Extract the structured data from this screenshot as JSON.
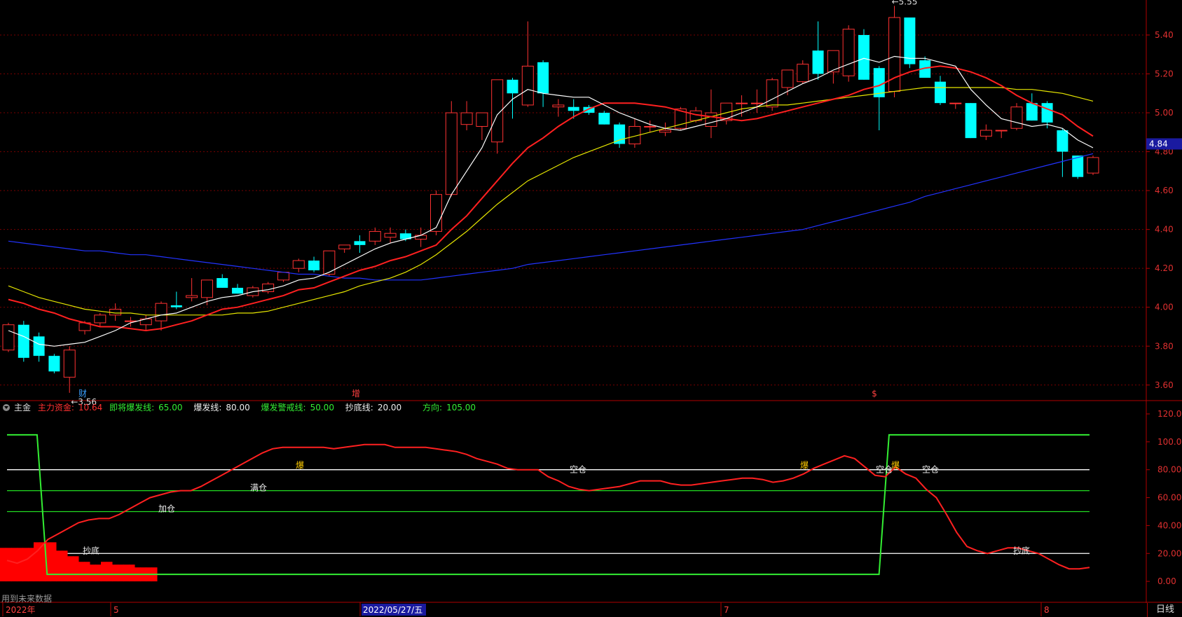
{
  "colors": {
    "up": "#ff3232",
    "down": "#00ffff",
    "ma5": "#ffffff",
    "ma10": "#ff2020",
    "ma20": "#e6e600",
    "ma60": "#2233ff",
    "grid": "#7a0000",
    "axis": "#b00000",
    "fund_line": "#ff2020",
    "direction_line": "#33ee33",
    "red_bars": "#ff0000"
  },
  "price_axis": {
    "ticks": [
      "5.40",
      "5.20",
      "5.00",
      "4.80",
      "4.60",
      "4.40",
      "4.20",
      "4.00",
      "3.80",
      "3.60"
    ],
    "last_price": "4.84"
  },
  "price_markers": {
    "low": "3.56",
    "high": "5.55"
  },
  "event_markers": [
    "财",
    "增",
    "$"
  ],
  "indicator": {
    "menu_icon": "menu-circle-icon",
    "name": "主金",
    "main_fund_label": "主力资金:",
    "main_fund_value": "10.64",
    "imminent_label": "即将爆发线:",
    "imminent_value": "65.00",
    "burst_label": "爆发线:",
    "burst_value": "80.00",
    "warn_label": "爆发警戒线:",
    "warn_value": "50.00",
    "bottom_label": "抄底线:",
    "bottom_value": "20.00",
    "dir_label": "方向:",
    "dir_value": "105.00",
    "axis_ticks": [
      "120.0",
      "100.0",
      "80.00",
      "60.00",
      "40.00",
      "20.00",
      "0.00"
    ],
    "annotations": [
      "抄底",
      "加仓",
      "满仓",
      "爆",
      "空仓",
      "爆",
      "空仓",
      "爆",
      "空仓",
      "抄底"
    ]
  },
  "timeline": {
    "labels": [
      "2022年",
      "5",
      "2022/05/27/五",
      "7",
      "8"
    ],
    "period": "日线"
  },
  "note": "用到未来数据",
  "chart_data": {
    "type": "candlestick",
    "price_range": [
      3.52,
      5.58
    ],
    "candles": [
      [
        3.78,
        3.92,
        3.77,
        3.91
      ],
      [
        3.91,
        3.93,
        3.72,
        3.74
      ],
      [
        3.85,
        3.87,
        3.72,
        3.75
      ],
      [
        3.75,
        3.76,
        3.66,
        3.67
      ],
      [
        3.64,
        3.8,
        3.56,
        3.78
      ],
      [
        3.88,
        3.93,
        3.86,
        3.92
      ],
      [
        3.92,
        3.97,
        3.9,
        3.96
      ],
      [
        3.96,
        4.02,
        3.93,
        3.99
      ],
      [
        3.93,
        3.95,
        3.9,
        3.93
      ],
      [
        3.91,
        3.96,
        3.88,
        3.94
      ],
      [
        3.93,
        4.03,
        3.88,
        4.02
      ],
      [
        4.01,
        4.08,
        3.99,
        4.0
      ],
      [
        4.05,
        4.15,
        4.03,
        4.06
      ],
      [
        4.05,
        4.13,
        4.01,
        4.14
      ],
      [
        4.15,
        4.17,
        4.1,
        4.1
      ],
      [
        4.1,
        4.12,
        4.07,
        4.07
      ],
      [
        4.06,
        4.11,
        4.05,
        4.1
      ],
      [
        4.08,
        4.13,
        4.07,
        4.12
      ],
      [
        4.14,
        4.18,
        4.13,
        4.18
      ],
      [
        4.2,
        4.25,
        4.18,
        4.24
      ],
      [
        4.24,
        4.26,
        4.18,
        4.19
      ],
      [
        4.17,
        4.26,
        4.16,
        4.29
      ],
      [
        4.3,
        4.32,
        4.28,
        4.32
      ],
      [
        4.34,
        4.37,
        4.28,
        4.32
      ],
      [
        4.34,
        4.41,
        4.32,
        4.39
      ],
      [
        4.36,
        4.41,
        4.33,
        4.38
      ],
      [
        4.38,
        4.4,
        4.34,
        4.35
      ],
      [
        4.35,
        4.41,
        4.31,
        4.37
      ],
      [
        4.39,
        4.6,
        4.37,
        4.58
      ],
      [
        4.58,
        5.06,
        4.57,
        5.0
      ],
      [
        4.94,
        5.06,
        4.91,
        5.0
      ],
      [
        4.93,
        5.0,
        4.86,
        5.0
      ],
      [
        4.85,
        5.17,
        4.79,
        5.17
      ],
      [
        5.17,
        5.18,
        4.97,
        5.1
      ],
      [
        5.04,
        5.47,
        5.03,
        5.24
      ],
      [
        5.26,
        5.27,
        5.03,
        5.1
      ],
      [
        5.03,
        5.07,
        4.98,
        5.04
      ],
      [
        5.03,
        5.07,
        4.97,
        5.01
      ],
      [
        5.03,
        5.04,
        4.99,
        5.0
      ],
      [
        5.0,
        5.01,
        4.94,
        4.94
      ],
      [
        4.94,
        4.95,
        4.82,
        4.84
      ],
      [
        4.84,
        4.97,
        4.82,
        4.93
      ],
      [
        4.93,
        4.96,
        4.9,
        4.93
      ],
      [
        4.9,
        4.95,
        4.88,
        4.91
      ],
      [
        4.92,
        5.03,
        4.91,
        5.02
      ],
      [
        4.96,
        5.03,
        4.95,
        5.01
      ],
      [
        4.93,
        5.12,
        4.87,
        5.0
      ],
      [
        4.96,
        5.04,
        4.94,
        5.05
      ],
      [
        5.05,
        5.09,
        4.98,
        5.05
      ],
      [
        5.05,
        5.12,
        5.0,
        5.05
      ],
      [
        5.03,
        5.18,
        5.01,
        5.17
      ],
      [
        5.13,
        5.22,
        5.09,
        5.22
      ],
      [
        5.16,
        5.27,
        5.15,
        5.25
      ],
      [
        5.32,
        5.47,
        5.17,
        5.2
      ],
      [
        5.21,
        5.32,
        5.15,
        5.32
      ],
      [
        5.19,
        5.45,
        5.16,
        5.43
      ],
      [
        5.4,
        5.43,
        5.17,
        5.17
      ],
      [
        5.23,
        5.24,
        4.91,
        5.08
      ],
      [
        5.11,
        5.55,
        5.08,
        5.49
      ],
      [
        5.49,
        5.49,
        5.23,
        5.25
      ],
      [
        5.27,
        5.29,
        5.2,
        5.18
      ],
      [
        5.16,
        5.19,
        5.04,
        5.05
      ],
      [
        5.05,
        5.05,
        5.02,
        5.05
      ],
      [
        5.05,
        5.05,
        4.87,
        4.87
      ],
      [
        4.88,
        4.94,
        4.86,
        4.91
      ],
      [
        4.91,
        4.91,
        4.87,
        4.91
      ],
      [
        4.92,
        5.05,
        4.91,
        5.03
      ],
      [
        5.05,
        5.1,
        4.96,
        4.96
      ],
      [
        5.05,
        5.06,
        4.92,
        4.95
      ],
      [
        4.91,
        4.92,
        4.67,
        4.8
      ],
      [
        4.78,
        4.78,
        4.66,
        4.67
      ],
      [
        4.69,
        4.78,
        4.68,
        4.77
      ]
    ],
    "ma5": [
      3.88,
      3.85,
      3.81,
      3.8,
      3.81,
      3.82,
      3.85,
      3.88,
      3.92,
      3.94,
      3.96,
      3.97,
      4.0,
      4.03,
      4.05,
      4.06,
      4.08,
      4.09,
      4.11,
      4.14,
      4.15,
      4.18,
      4.22,
      4.26,
      4.3,
      4.33,
      4.35,
      4.37,
      4.41,
      4.58,
      4.7,
      4.82,
      4.99,
      5.07,
      5.12,
      5.1,
      5.09,
      5.08,
      5.08,
      5.04,
      5.0,
      4.97,
      4.94,
      4.92,
      4.91,
      4.93,
      4.95,
      4.97,
      5.0,
      5.03,
      5.07,
      5.11,
      5.15,
      5.18,
      5.22,
      5.25,
      5.28,
      5.26,
      5.29,
      5.28,
      5.28,
      5.26,
      5.24,
      5.12,
      5.04,
      4.97,
      4.95,
      4.93,
      4.94,
      4.92,
      4.86,
      4.82
    ],
    "ma10": [
      4.04,
      4.02,
      3.99,
      3.97,
      3.94,
      3.92,
      3.9,
      3.9,
      3.89,
      3.88,
      3.89,
      3.91,
      3.93,
      3.96,
      3.99,
      4.0,
      4.02,
      4.04,
      4.06,
      4.09,
      4.1,
      4.13,
      4.16,
      4.19,
      4.21,
      4.24,
      4.26,
      4.29,
      4.32,
      4.4,
      4.47,
      4.56,
      4.65,
      4.74,
      4.82,
      4.87,
      4.93,
      4.98,
      5.02,
      5.05,
      5.05,
      5.05,
      5.04,
      5.03,
      5.01,
      4.99,
      4.98,
      4.97,
      4.96,
      4.97,
      4.99,
      5.01,
      5.03,
      5.05,
      5.07,
      5.09,
      5.12,
      5.14,
      5.18,
      5.21,
      5.23,
      5.24,
      5.23,
      5.21,
      5.18,
      5.14,
      5.09,
      5.05,
      5.02,
      4.99,
      4.93,
      4.88
    ],
    "ma20": [
      4.11,
      4.08,
      4.05,
      4.03,
      4.01,
      3.99,
      3.98,
      3.97,
      3.97,
      3.96,
      3.96,
      3.96,
      3.96,
      3.96,
      3.96,
      3.97,
      3.97,
      3.98,
      4.0,
      4.02,
      4.04,
      4.06,
      4.08,
      4.11,
      4.13,
      4.15,
      4.18,
      4.22,
      4.27,
      4.33,
      4.39,
      4.46,
      4.53,
      4.59,
      4.65,
      4.69,
      4.73,
      4.77,
      4.8,
      4.83,
      4.86,
      4.88,
      4.9,
      4.92,
      4.94,
      4.96,
      4.98,
      5.0,
      5.02,
      5.03,
      5.04,
      5.04,
      5.05,
      5.06,
      5.07,
      5.08,
      5.09,
      5.1,
      5.11,
      5.12,
      5.13,
      5.13,
      5.13,
      5.13,
      5.13,
      5.13,
      5.12,
      5.12,
      5.11,
      5.1,
      5.08,
      5.06
    ],
    "ma60": [
      4.34,
      4.33,
      4.32,
      4.31,
      4.3,
      4.29,
      4.29,
      4.28,
      4.27,
      4.27,
      4.26,
      4.25,
      4.24,
      4.23,
      4.22,
      4.21,
      4.2,
      4.19,
      4.18,
      4.17,
      4.17,
      4.16,
      4.15,
      4.15,
      4.14,
      4.14,
      4.14,
      4.14,
      4.15,
      4.16,
      4.17,
      4.18,
      4.19,
      4.2,
      4.22,
      4.23,
      4.24,
      4.25,
      4.26,
      4.27,
      4.28,
      4.29,
      4.3,
      4.31,
      4.32,
      4.33,
      4.34,
      4.35,
      4.36,
      4.37,
      4.38,
      4.39,
      4.4,
      4.42,
      4.44,
      4.46,
      4.48,
      4.5,
      4.52,
      4.54,
      4.57,
      4.59,
      4.61,
      4.63,
      4.65,
      4.67,
      4.69,
      4.71,
      4.73,
      4.75,
      4.77,
      4.79
    ],
    "indicator_range": [
      -15,
      120
    ],
    "main_fund": [
      15,
      13,
      16,
      22,
      30,
      34,
      38,
      42,
      44,
      45,
      45,
      48,
      52,
      56,
      60,
      62,
      64,
      65,
      65,
      68,
      72,
      76,
      80,
      84,
      88,
      92,
      95,
      96,
      96,
      96,
      96,
      96,
      95,
      96,
      97,
      98,
      98,
      98,
      96,
      96,
      96,
      96,
      95,
      94,
      93,
      91,
      88,
      86,
      84,
      81,
      80,
      80,
      80,
      75,
      72,
      68,
      66,
      65,
      66,
      67,
      68,
      70,
      72,
      72,
      72,
      70,
      69,
      69,
      70,
      71,
      72,
      73,
      74,
      74,
      73,
      71,
      72,
      74,
      77,
      81,
      84,
      87,
      90,
      88,
      82,
      76,
      75,
      82,
      77,
      74,
      66,
      60,
      48,
      35,
      25,
      22,
      20,
      22,
      24,
      24,
      22,
      20,
      16,
      12,
      9,
      9,
      10
    ],
    "direction": [
      105,
      105,
      105,
      105,
      5,
      5,
      5,
      5,
      5,
      5,
      5,
      5,
      5,
      5,
      5,
      5,
      5,
      5,
      5,
      5,
      5,
      5,
      5,
      5,
      5,
      5,
      5,
      5,
      5,
      5,
      5,
      5,
      5,
      5,
      5,
      5,
      5,
      5,
      5,
      5,
      5,
      5,
      5,
      5,
      5,
      5,
      5,
      5,
      5,
      5,
      5,
      5,
      5,
      5,
      5,
      5,
      5,
      5,
      5,
      5,
      5,
      5,
      5,
      5,
      5,
      5,
      5,
      5,
      5,
      5,
      5,
      5,
      5,
      5,
      5,
      5,
      5,
      5,
      5,
      5,
      5,
      5,
      5,
      5,
      5,
      5,
      5,
      5,
      105,
      105,
      105,
      105,
      105,
      105,
      105,
      105,
      105,
      105,
      105,
      105,
      105,
      105,
      105,
      105,
      105,
      105,
      105,
      105,
      105
    ],
    "red_bars": [
      24,
      24,
      24,
      24,
      24,
      24,
      28,
      28,
      28,
      28,
      22,
      22,
      18,
      18,
      14,
      14,
      12,
      12,
      14,
      14,
      12,
      12,
      12,
      12,
      10,
      10,
      10,
      10
    ],
    "levels": [
      80,
      65,
      50,
      20
    ]
  }
}
